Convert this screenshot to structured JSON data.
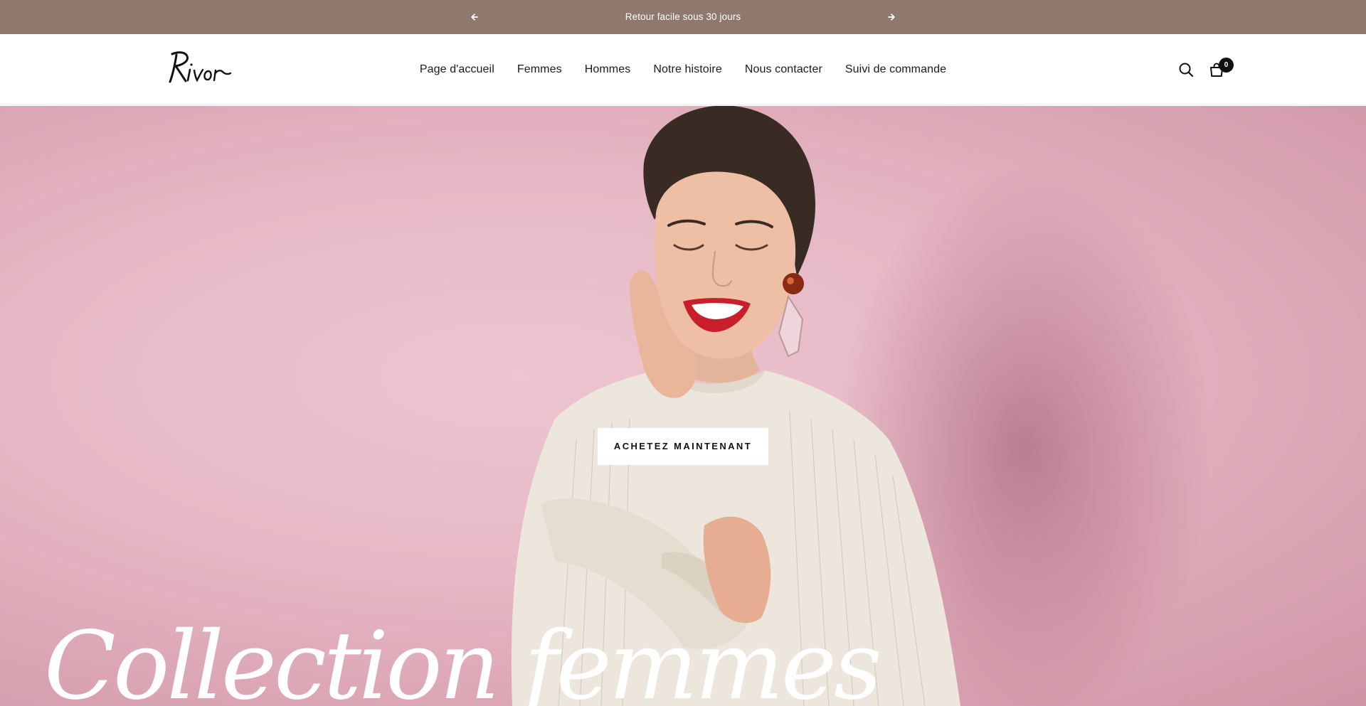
{
  "announcement": {
    "text": "Retour facile sous 30 jours",
    "prev_icon": "arrow-left-icon",
    "next_icon": "arrow-right-icon"
  },
  "header": {
    "logo_text": "Rivor",
    "nav": [
      {
        "label": "Page d'accueil"
      },
      {
        "label": "Femmes"
      },
      {
        "label": "Hommes"
      },
      {
        "label": "Notre histoire"
      },
      {
        "label": "Nous contacter"
      },
      {
        "label": "Suivi de commande"
      }
    ],
    "search_icon": "search-icon",
    "cart_icon": "shopping-bag-icon",
    "cart_count": "0"
  },
  "hero": {
    "cta_label": "ACHETEZ MAINTENANT",
    "title": "Collection femmes"
  },
  "colors": {
    "announcement_bg": "#8f786d",
    "hero_bg": "#e7b9c6",
    "text": "#1a1a1a"
  }
}
